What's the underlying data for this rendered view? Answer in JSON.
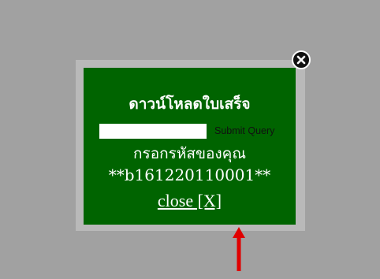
{
  "modal": {
    "title": "ดาวน์โหลดใบเสร็จ",
    "input": {
      "value": "",
      "placeholder": ""
    },
    "submit_label": "Submit Query",
    "instruction": "กรอกรหัสของคุณ",
    "code": "**b161220110001**",
    "close_label": "close [X]"
  },
  "icons": {
    "close": "close-icon",
    "arrow": "arrow-up-icon"
  },
  "colors": {
    "page_background": "#a1a1a1",
    "frame": "#b9b9b9",
    "modal_background": "#006400",
    "text": "#ffffff",
    "arrow": "#e00000"
  }
}
